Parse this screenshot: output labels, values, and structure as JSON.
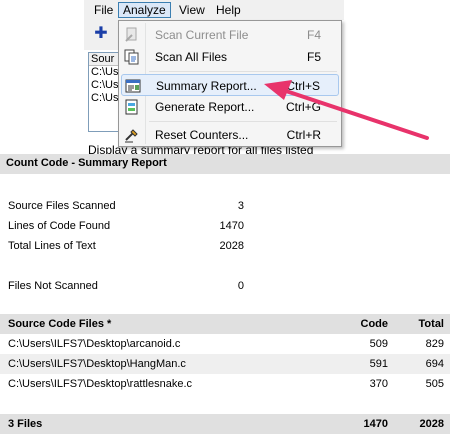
{
  "menubar": {
    "items": [
      {
        "label": "File"
      },
      {
        "label": "Analyze"
      },
      {
        "label": "View"
      },
      {
        "label": "Help"
      }
    ]
  },
  "file_list": {
    "header": "Sour",
    "rows": [
      "C:\\Us",
      "C:\\Us",
      "C:\\Us"
    ]
  },
  "status_text": "Display a summary report for all files listed",
  "analyze_menu": {
    "items": [
      {
        "label": "Scan Current File",
        "shortcut": "F4",
        "icon": "scan-file-icon",
        "enabled": false
      },
      {
        "label": "Scan All Files",
        "shortcut": "F5",
        "icon": "scan-all-icon",
        "enabled": true
      },
      {
        "label": "Summary Report...",
        "shortcut": "Ctrl+S",
        "icon": "summary-report-icon",
        "enabled": true,
        "highlighted": true
      },
      {
        "label": "Generate Report...",
        "shortcut": "Ctrl+G",
        "icon": "generate-report-icon",
        "enabled": true
      },
      {
        "label": "Reset Counters...",
        "shortcut": "Ctrl+R",
        "icon": "reset-counters-icon",
        "enabled": true
      }
    ]
  },
  "annotation": {
    "arrow_color": "#e8336b"
  },
  "report": {
    "title": "Count Code - Summary Report",
    "stats": [
      {
        "label": "Source Files Scanned",
        "value": "3"
      },
      {
        "label": "Lines of Code Found",
        "value": "1470"
      },
      {
        "label": "Total Lines of Text",
        "value": "2028"
      },
      {
        "label": "Files Not Scanned",
        "value": "0"
      }
    ],
    "table": {
      "headers": {
        "file": "Source Code Files *",
        "code": "Code",
        "total": "Total"
      },
      "rows": [
        {
          "file": "C:\\Users\\ILFS7\\Desktop\\arcanoid.c",
          "code": "509",
          "total": "829"
        },
        {
          "file": "C:\\Users\\ILFS7\\Desktop\\HangMan.c",
          "code": "591",
          "total": "694"
        },
        {
          "file": "C:\\Users\\ILFS7\\Desktop\\rattlesnake.c",
          "code": "370",
          "total": "505"
        }
      ],
      "footer": {
        "file": "3 Files",
        "code": "1470",
        "total": "2028"
      }
    }
  }
}
